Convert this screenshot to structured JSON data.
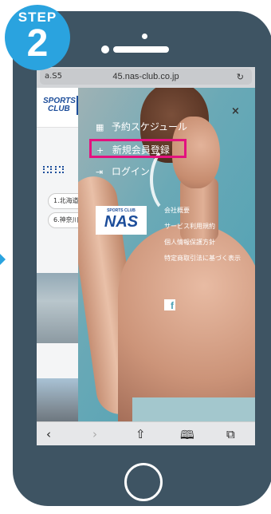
{
  "step": {
    "label": "STEP",
    "number": "2"
  },
  "browser": {
    "url_left": "a.S5",
    "url_text": "45.nas-club.co.jp",
    "reload_icon": "reload-icon"
  },
  "background_page": {
    "logo_line1": "SPORTS",
    "logo_line2": "CLUB",
    "chips": [
      "1.北海道",
      "6.神奈川"
    ]
  },
  "menu": {
    "items": [
      {
        "icon": "calendar-icon",
        "glyph": "▦",
        "label": "予約スケジュール"
      },
      {
        "icon": "user-plus-icon",
        "glyph": "👤",
        "label": "新規会員登録"
      },
      {
        "icon": "login-icon",
        "glyph": "⇥",
        "label": "ログイン"
      }
    ],
    "close_glyph": "×",
    "logo_small": "SPORTS CLUB",
    "logo_big": "NAS",
    "links": [
      "会社概要",
      "サービス利用規約",
      "個人情報保護方針",
      "特定商取引法に基づく表示"
    ],
    "facebook_glyph": "f"
  },
  "toolbar": {
    "back": "‹",
    "forward": "›",
    "share": "⇧",
    "bookmarks": "🕮",
    "tabs": "⧉"
  },
  "colors": {
    "step_badge": "#2aa3df",
    "phone_body": "#3e5463",
    "highlight_border": "#e3127f",
    "brand_blue": "#1c4d9a"
  }
}
